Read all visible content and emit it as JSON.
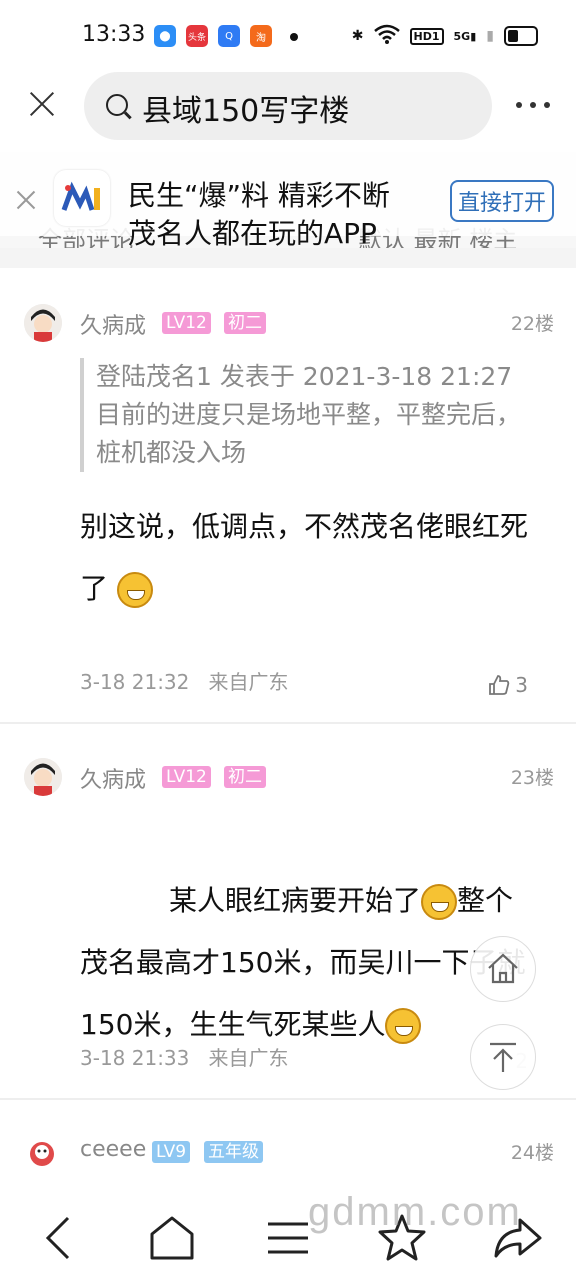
{
  "status_bar": {
    "time": "13:33",
    "app_icons": [
      "头条",
      "淘"
    ],
    "network": "5G",
    "hd": "HD1"
  },
  "search": {
    "query": "县域150写字楼"
  },
  "banner": {
    "line1": "民生“爆”料 精彩不断",
    "line2": "茂名人都在玩的APP",
    "open_label": "直接打开",
    "partial_under": {
      "left": "全部评论",
      "right": "默认  最新  楼主"
    }
  },
  "posts": [
    {
      "username": "久病成",
      "level": "LV12",
      "rank": "初二",
      "floor": "22楼",
      "quote": "登陆茂名1 发表于 2021-3-18 21:27目前的进度只是场地平整，平整完后，桩机都没入场",
      "content": "别这说，低调点，不然茂名佬眼红死了",
      "time": "3-18 21:32",
      "location": "来自广东",
      "likes": "3"
    },
    {
      "username": "久病成",
      "level": "LV12",
      "rank": "初二",
      "floor": "23楼",
      "content_parts": [
        "      某人眼红病要开始了",
        "整个茂名最高才150米，而吴川一下子就150米，生生气死某些人"
      ],
      "time": "3-18 21:33",
      "location": "来自广东",
      "likes": "2"
    },
    {
      "username": "ceeee",
      "level": "LV9",
      "rank": "五年级",
      "floor": "24楼"
    }
  ],
  "watermark": "gdmm.com",
  "colors": {
    "level_badge_pink": "#f59ad6",
    "level_badge_blue": "#8ec7f2",
    "accent_blue": "#2f6fb8"
  }
}
